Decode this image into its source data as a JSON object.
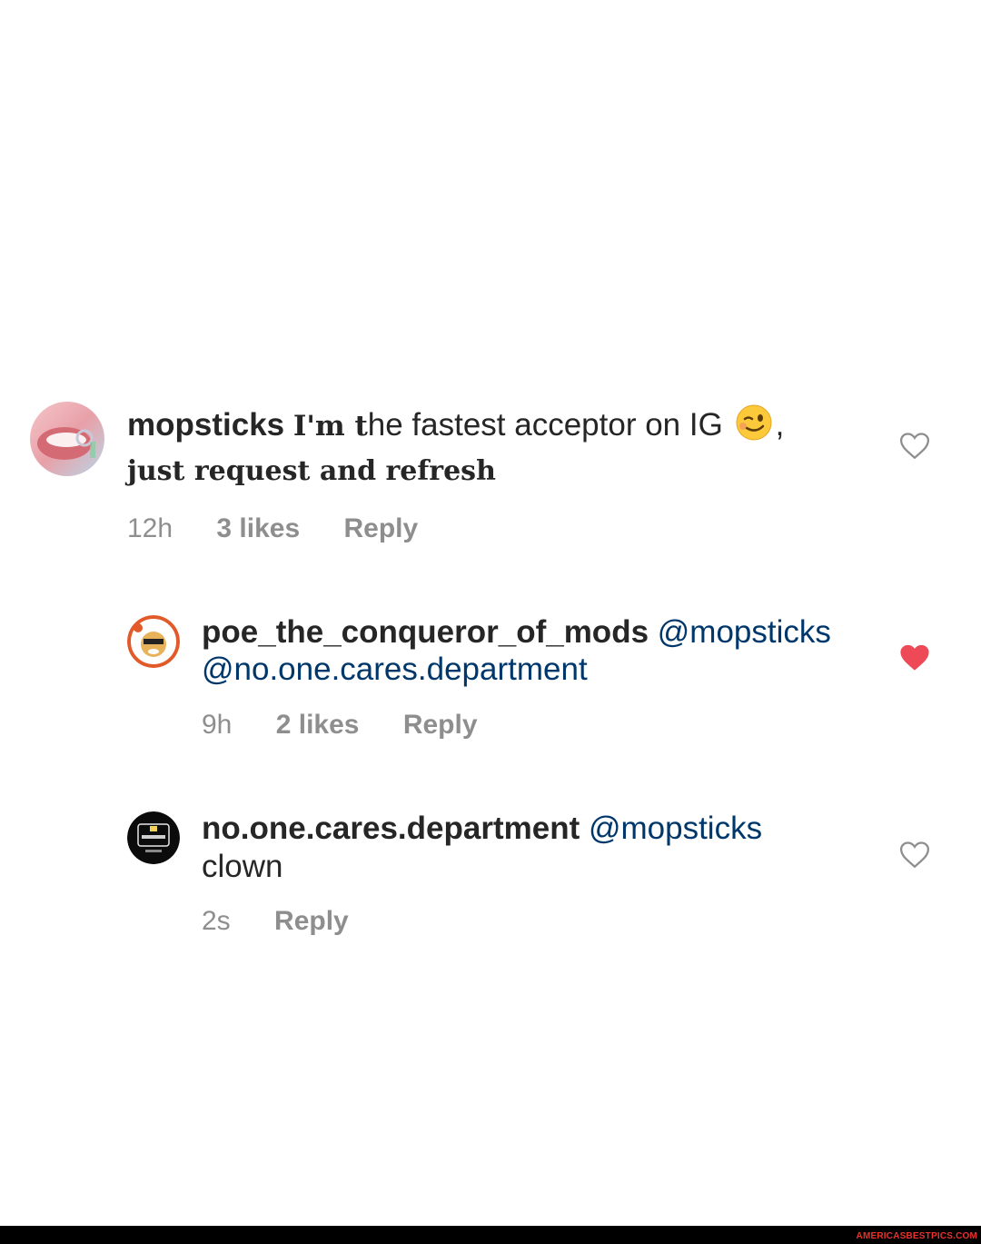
{
  "comments": [
    {
      "username": "mopsticks",
      "text_serif": "I'm t",
      "text_plain": "he fastest acceptor on IG",
      "emoji": "winking-face-emoji",
      "text_after_emoji": ",",
      "line2": "just request and refresh",
      "time": "12h",
      "likes": "3 likes",
      "reply": "Reply",
      "liked": false
    },
    {
      "username": "poe_the_conqueror_of_mods",
      "mention1": "@mopsticks",
      "mention2": "@no.one.cares.department",
      "time": "9h",
      "likes": "2 likes",
      "reply": "Reply",
      "liked": true
    },
    {
      "username": "no.one.cares.department",
      "mention1": "@mopsticks",
      "line2": "clown",
      "time": "2s",
      "reply": "Reply",
      "liked": false
    }
  ],
  "footer": {
    "watermark": "AMERICASBESTPICS.COM"
  },
  "colors": {
    "mention": "#00376b",
    "meta": "#8e8e8e",
    "liked_heart": "#ed4956"
  }
}
